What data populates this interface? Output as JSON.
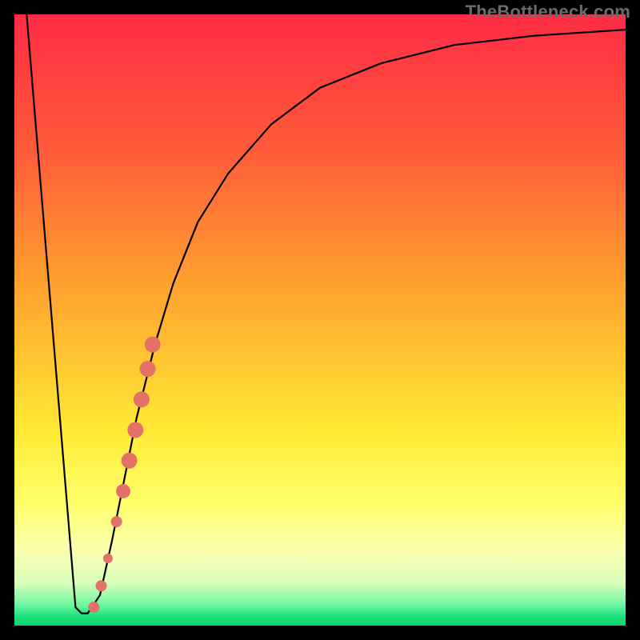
{
  "watermark": "TheBottleneck.com",
  "chart_data": {
    "type": "line",
    "title": "",
    "xlabel": "",
    "ylabel": "",
    "xlim": [
      0,
      100
    ],
    "ylim": [
      0,
      100
    ],
    "series": [
      {
        "name": "bottleneck-curve",
        "x": [
          2,
          10,
          11,
          12,
          14,
          16,
          18,
          20,
          23,
          26,
          30,
          35,
          42,
          50,
          60,
          72,
          85,
          100
        ],
        "y": [
          100,
          3,
          2,
          2,
          5,
          14,
          24,
          34,
          46,
          56,
          66,
          74,
          82,
          88,
          92,
          95,
          96.5,
          97.5
        ]
      }
    ],
    "markers": {
      "name": "highlight-dots",
      "color": "#e37167",
      "points": [
        {
          "x": 13.0,
          "y": 3.0,
          "r": 7
        },
        {
          "x": 14.2,
          "y": 6.5,
          "r": 7
        },
        {
          "x": 15.3,
          "y": 11.0,
          "r": 6
        },
        {
          "x": 16.7,
          "y": 17.0,
          "r": 7
        },
        {
          "x": 17.8,
          "y": 22.0,
          "r": 9
        },
        {
          "x": 18.8,
          "y": 27.0,
          "r": 10
        },
        {
          "x": 19.8,
          "y": 32.0,
          "r": 10
        },
        {
          "x": 20.8,
          "y": 37.0,
          "r": 10
        },
        {
          "x": 21.8,
          "y": 42.0,
          "r": 10
        },
        {
          "x": 22.6,
          "y": 46.0,
          "r": 10
        }
      ]
    },
    "background_gradient": {
      "stops": [
        {
          "pos": 0,
          "color": "#ff2c44"
        },
        {
          "pos": 0.22,
          "color": "#ff5a3a"
        },
        {
          "pos": 0.44,
          "color": "#ffa02e"
        },
        {
          "pos": 0.68,
          "color": "#ffe935"
        },
        {
          "pos": 0.8,
          "color": "#ffff6a"
        },
        {
          "pos": 0.88,
          "color": "#faffb2"
        },
        {
          "pos": 0.93,
          "color": "#d6ffba"
        },
        {
          "pos": 0.965,
          "color": "#72f7a2"
        },
        {
          "pos": 0.985,
          "color": "#1ce27d"
        },
        {
          "pos": 1.0,
          "color": "#0bd36e"
        }
      ]
    }
  }
}
